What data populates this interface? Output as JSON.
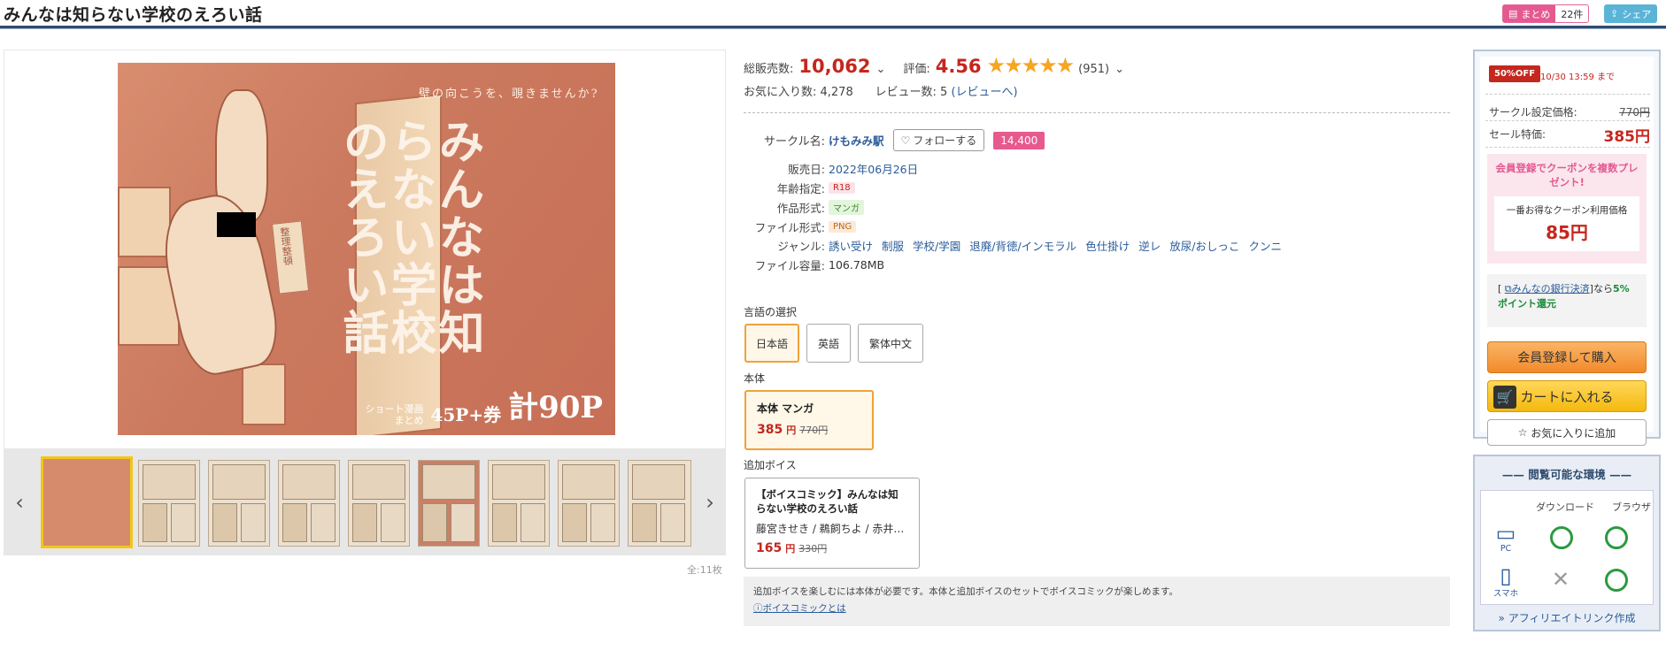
{
  "header": {
    "title": "みんなは知らない学校のえろい話",
    "matome_label": "まとめ",
    "matome_count": "22件",
    "share_label": "シェア"
  },
  "gallery": {
    "cover": {
      "tagline": "壁の向こうを、覗きませんか?",
      "title_vertical": "みんなは知らない学校のえろい話",
      "pages_small_1": "ショート漫画",
      "pages_small_2": "まとめ",
      "pages_mid": "45P+券",
      "pages_big": "計90P",
      "sign": "整理整頓"
    },
    "thumb_count": 9,
    "image_count": "全:11枚"
  },
  "stats": {
    "sales_label": "総販売数:",
    "sales_value": "10,062",
    "rating_label": "評価:",
    "rating_value": "4.56",
    "rating_stars": "★★★★★",
    "rating_count": "(951)",
    "favorites": "お気に入り数: 4,278",
    "reviews_label": "レビュー数: 5",
    "reviews_link": "(レビューへ)"
  },
  "specs": {
    "circle_label": "サークル名:",
    "circle_value": "けもみみ駅",
    "follow_label": "フォローする",
    "follow_count": "14,400",
    "release_label": "販売日:",
    "release_value": "2022年06月26日",
    "age_label": "年齢指定:",
    "age_value": "R18",
    "format_label": "作品形式:",
    "format_value": "マンガ",
    "file_label": "ファイル形式:",
    "file_value": "PNG",
    "genre_label": "ジャンル:",
    "genres": [
      "誘い受け",
      "制服",
      "学校/学園",
      "退廃/背徳/インモラル",
      "色仕掛け",
      "逆レ",
      "放尿/おしっこ",
      "クンニ"
    ],
    "size_label": "ファイル容量:",
    "size_value": "106.78MB"
  },
  "language": {
    "label": "言語の選択",
    "options": [
      "日本語",
      "英語",
      "繁体中文"
    ]
  },
  "main_product": {
    "label": "本体",
    "name": "本体 マンガ",
    "price": "385",
    "unit": "円",
    "orig": "770円"
  },
  "voice": {
    "label": "追加ボイス",
    "name": "【ボイスコミック】みんなは知らない学校のえろい話",
    "authors": "藤宮きせき / 鵜飼ちよ / 赤井…",
    "price": "165",
    "unit": "円",
    "orig": "330円"
  },
  "note": {
    "text": "追加ボイスを楽しむには本体が必要です。本体と追加ボイスのセットでボイスコミックが楽しめます。",
    "link": "ボイスコミックとは"
  },
  "sidebar": {
    "off_badge": "50%OFF",
    "off_time": "10/30 13:59 まで",
    "set_price_label": "サークル設定価格:",
    "set_price_value": "770円",
    "sale_label": "セール特価:",
    "sale_value": "385円",
    "coupon_head": "会員登録でクーポンを複数プレゼント!",
    "coupon_sub": "一番お得なクーポン利用価格",
    "coupon_price": "85円",
    "bank_link": "みんなの銀行決済",
    "bank_text_pre": "[",
    "bank_text_mid": "]なら",
    "bank_bold": "5%ポイント還元",
    "register_btn": "会員登録して購入",
    "cart_btn": "カートに入れる",
    "fav_btn": "お気に入りに追加"
  },
  "env": {
    "title": "閲覧可能な環境",
    "col_download": "ダウンロード",
    "col_browser": "ブラウザ",
    "pc_label": "PC",
    "sp_label": "スマホ",
    "affiliate": "» アフィリエイトリンク作成"
  },
  "colors": {
    "accent_red": "#c5261d",
    "header_rule": "#2f4b6e",
    "pink": "#e45a90",
    "orange_button": "#f28a2a",
    "yellow_button": "#f4b90e"
  }
}
